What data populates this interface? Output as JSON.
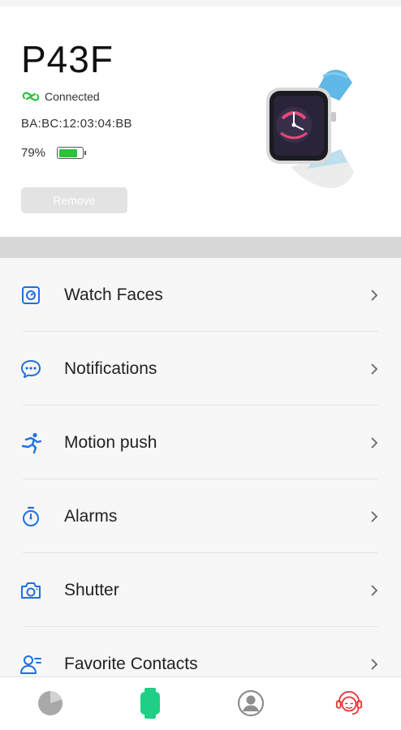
{
  "device": {
    "name": "P43F",
    "status": "Connected",
    "mac": "BA:BC:12:03:04:BB",
    "battery_text": "79%",
    "battery_level": 0.79,
    "remove_label": "Remove"
  },
  "menu": {
    "items": [
      {
        "label": "Watch Faces",
        "icon": "watch-face-icon"
      },
      {
        "label": "Notifications",
        "icon": "chat-bubble-icon"
      },
      {
        "label": "Motion push",
        "icon": "runner-icon"
      },
      {
        "label": "Alarms",
        "icon": "stopwatch-icon"
      },
      {
        "label": "Shutter",
        "icon": "camera-icon"
      },
      {
        "label": "Favorite Contacts",
        "icon": "contacts-icon"
      }
    ]
  },
  "nav": {
    "items": [
      {
        "icon": "pie-chart-icon"
      },
      {
        "icon": "watch-icon"
      },
      {
        "icon": "profile-icon"
      },
      {
        "icon": "support-agent-icon"
      }
    ]
  },
  "colors": {
    "accent_blue": "#1f6fe0",
    "status_green": "#2ac33b",
    "nav_active": "#1fcf85",
    "nav_inactive": "#9a9a9a",
    "support_red": "#e63b3b"
  }
}
